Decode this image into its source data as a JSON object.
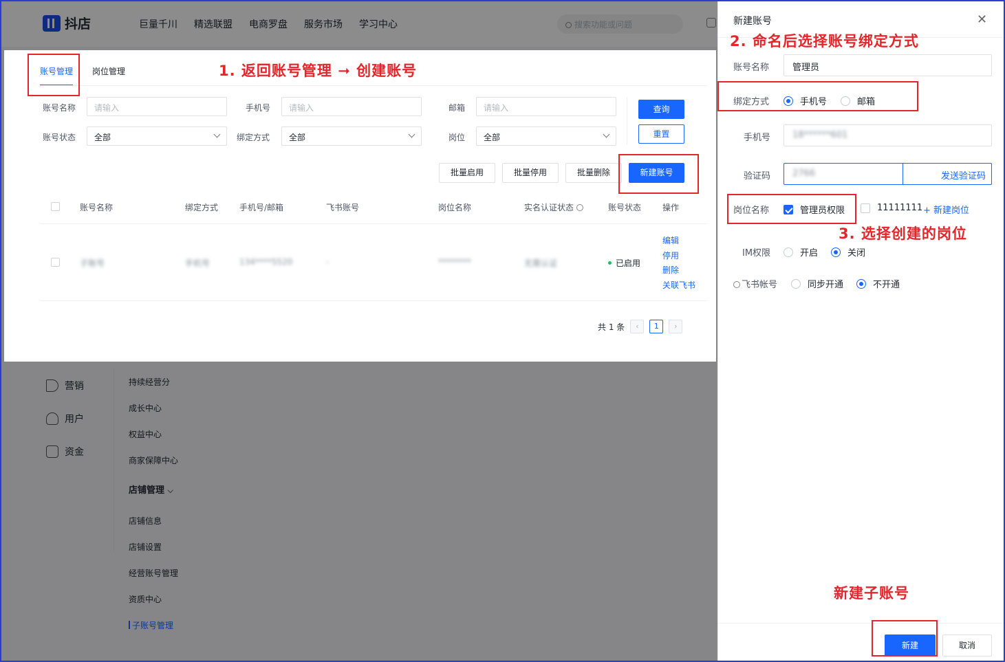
{
  "topbar": {
    "logo_text": "抖店",
    "nav": [
      "巨量千川",
      "精选联盟",
      "电商罗盘",
      "服务市场",
      "学习中心"
    ],
    "search_placeholder": "搜索功能或问题"
  },
  "sidebar": {
    "primary": [
      {
        "label": "营销",
        "icon": "megaphone-icon"
      },
      {
        "label": "用户",
        "icon": "user-icon"
      },
      {
        "label": "资金",
        "icon": "wallet-icon"
      }
    ],
    "secondary_top": [
      "持续经营分",
      "成长中心",
      "权益中心",
      "商家保障中心"
    ],
    "section_title": "店铺管理",
    "section_items": [
      "店铺信息",
      "店铺设置",
      "经营账号管理",
      "资质中心"
    ],
    "active_item": "子账号管理"
  },
  "tabs": [
    {
      "label": "账号管理",
      "active": true
    },
    {
      "label": "岗位管理",
      "active": false
    }
  ],
  "filters": {
    "account_name": {
      "label": "账号名称",
      "placeholder": "请输入"
    },
    "phone": {
      "label": "手机号",
      "placeholder": "请输入"
    },
    "email": {
      "label": "邮箱",
      "placeholder": "请输入"
    },
    "status": {
      "label": "账号状态",
      "value": "全部"
    },
    "bind": {
      "label": "绑定方式",
      "value": "全部"
    },
    "position": {
      "label": "岗位",
      "value": "全部"
    },
    "query_btn": "查询",
    "reset_btn": "重置"
  },
  "actions": {
    "batch_enable": "批量启用",
    "batch_disable": "批量停用",
    "batch_delete": "批量删除",
    "create": "新建账号"
  },
  "table": {
    "columns": [
      "账号名称",
      "绑定方式",
      "手机号/邮箱",
      "飞书账号",
      "岗位名称",
      "实名认证状态",
      "账号状态",
      "操作"
    ],
    "rows": [
      {
        "name": "子账号",
        "bind": "手机号",
        "contact": "134****5520",
        "feishu": "-",
        "position": "********",
        "verify": "无需认证",
        "status": "已启用",
        "ops": [
          "编辑",
          "停用",
          "删除",
          "关联飞书"
        ]
      }
    ]
  },
  "pager": {
    "total": "共 1 条",
    "current": "1"
  },
  "drawer": {
    "title": "新建账号",
    "name_label": "账号名称",
    "name_value": "管理员",
    "bind_label": "绑定方式",
    "bind_options": [
      "手机号",
      "邮箱"
    ],
    "phone_label": "手机号",
    "phone_value": "18******601",
    "code_label": "验证码",
    "code_value": "2766",
    "send_code": "发送验证码",
    "position_label": "岗位名称",
    "position_options": [
      "管理员权限",
      "11111111"
    ],
    "add_position": "新建岗位",
    "im_label": "IM权限",
    "im_options": [
      "开启",
      "关闭"
    ],
    "feishu_label": "飞书帐号",
    "feishu_options": [
      "同步开通",
      "不开通"
    ],
    "create_btn": "新建",
    "cancel_btn": "取消"
  },
  "annotations": {
    "step1": "1. 返回账号管理 ➞ 创建账号",
    "step2": "2. 命名后选择账号绑定方式",
    "step3": "3. 选择创建的岗位",
    "step4": "新建子账号"
  },
  "colors": {
    "primary": "#1966ff",
    "annotation": "#e5252a",
    "frame": "#2b3bd6"
  }
}
